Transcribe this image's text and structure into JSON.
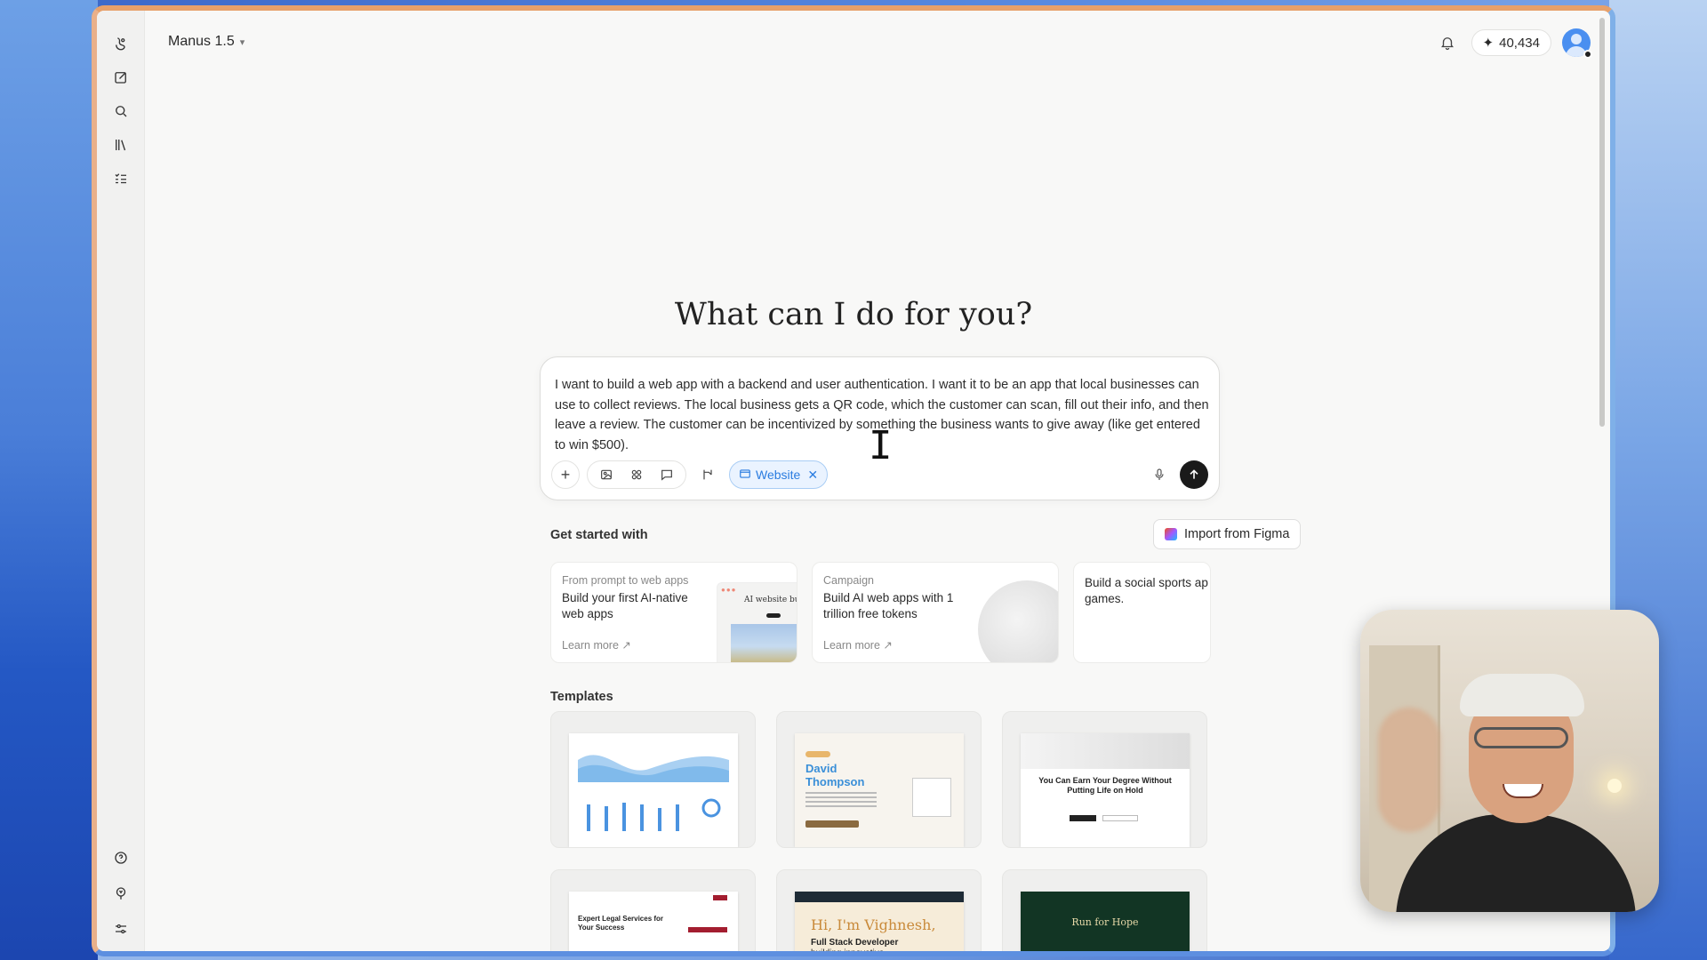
{
  "app": {
    "model_selector": "Manus 1.5",
    "credits": "40,434"
  },
  "hero": {
    "title": "What can I do for you?"
  },
  "composer": {
    "text": "I want to build a web app with a backend and user authentication. I want it to be an app that local businesses can use to collect reviews. The local business gets a QR code, which the customer can scan, fill out their info, and then leave a review. The customer can be incentivized by something the business wants to give away (like get entered to win $500).",
    "mode_chip": "Website"
  },
  "get_started": {
    "label": "Get started with",
    "figma_button": "Import from Figma",
    "cards": [
      {
        "eyebrow": "From prompt to web apps",
        "title": "Build your first AI-native web apps",
        "more": "Learn more ↗",
        "thumb_title": "AI website build"
      },
      {
        "eyebrow": "Campaign",
        "title": "Build AI web apps with 1 trillion free tokens",
        "more": "Learn more ↗"
      },
      {
        "title": "Build a social sports ap games."
      }
    ]
  },
  "templates": {
    "label": "Templates",
    "items": [
      {
        "name": "analytics-dashboard"
      },
      {
        "name": "portfolio",
        "title": "David Thompson"
      },
      {
        "name": "education",
        "title": "You Can Earn Your Degree Without Putting Life on Hold"
      },
      {
        "name": "legal",
        "title": "Expert Legal Services for Your Success"
      },
      {
        "name": "developer-portfolio",
        "title": "Hi, I'm Vighnesh,",
        "subtitle": "Full Stack Developer",
        "subtitle2": "building innovative"
      },
      {
        "name": "charity",
        "title": "Run for Hope"
      }
    ]
  },
  "colors": {
    "chip_blue": "#2a7ce0",
    "send_button": "#1a1a1a",
    "window_bg": "#f8f8f7"
  },
  "icons": {
    "sidebar": [
      "manus-logo-icon",
      "new-task-icon",
      "search-icon",
      "library-icon",
      "tasks-list-icon",
      "help-icon",
      "idea-icon",
      "settings-sliders-icon"
    ]
  }
}
